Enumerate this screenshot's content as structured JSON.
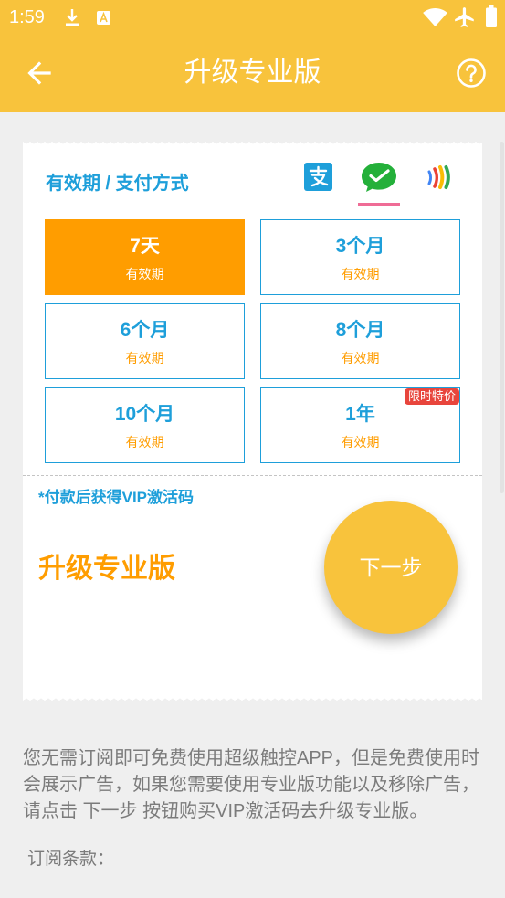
{
  "colors": {
    "primary_yellow": "#F8C33C",
    "accent_blue": "#1E9FDA",
    "accent_orange": "#FF9D00",
    "badge_red": "#E8453C",
    "page_bg": "#EFEFEF",
    "body_text": "#7B7B7B",
    "selection_pink": "#EF6C96"
  },
  "status_bar": {
    "time": "1:59",
    "left_icons": [
      "download-icon",
      "a-notification-icon"
    ],
    "right_icons": [
      "wifi-icon",
      "airplane-mode-icon",
      "battery-icon"
    ]
  },
  "app_bar": {
    "title": "升级专业版",
    "back_icon": "arrow-back-icon",
    "help_icon": "help-icon"
  },
  "purchase_card": {
    "section_title": "有效期 / 支付方式",
    "payment_methods": [
      {
        "icon": "alipay-icon",
        "logo_text": "支",
        "selected": false
      },
      {
        "icon": "wechat-pay-icon",
        "selected": true
      },
      {
        "icon": "wallet-icon",
        "selected": false
      }
    ],
    "plans": [
      {
        "duration": "7天",
        "label": "有效期",
        "selected": true
      },
      {
        "duration": "3个月",
        "label": "有效期",
        "selected": false
      },
      {
        "duration": "6个月",
        "label": "有效期",
        "selected": false
      },
      {
        "duration": "8个月",
        "label": "有效期",
        "selected": false
      },
      {
        "duration": "10个月",
        "label": "有效期",
        "selected": false
      },
      {
        "duration": "1年",
        "label": "有效期",
        "selected": false,
        "badge": "限时特价"
      }
    ],
    "note": "*付款后获得VIP激活码",
    "upgrade_title": "升级专业版",
    "next_button_label": "下一步"
  },
  "description": {
    "lines": [
      "您无需订阅即可免费使用超级触控APP，但是免费使用时",
      "会展示广告，如果您需要使用专业版功能以及移除广告，",
      "请点击 下一步 按钮购买VIP激活码去升级专业版。"
    ]
  },
  "terms": {
    "label": "订阅条款："
  }
}
